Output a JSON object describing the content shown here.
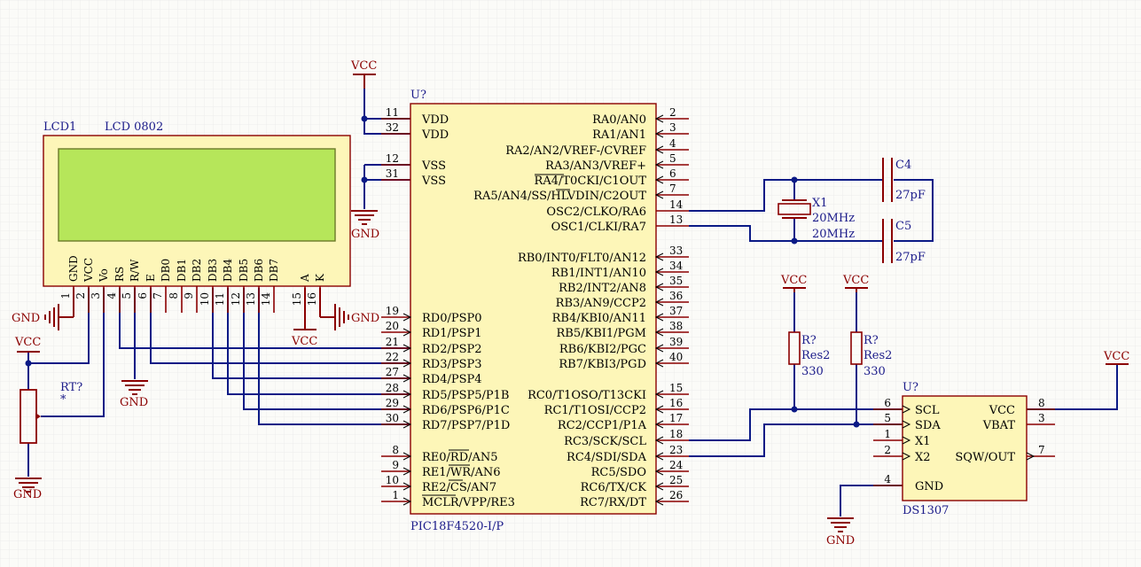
{
  "nets": {
    "vcc": "VCC",
    "gnd": "GND"
  },
  "lcd": {
    "designator": "LCD1",
    "part": "LCD 0802",
    "screen_color": "#b6e65a",
    "pin_names": [
      "GND",
      "VCC",
      "Vo",
      "RS",
      "R/W",
      "E",
      "DB0",
      "DB1",
      "DB2",
      "DB3",
      "DB4",
      "DB5",
      "DB6",
      "DB7",
      "A",
      "K"
    ],
    "pin_numbers": [
      "1",
      "2",
      "3",
      "4",
      "5",
      "6",
      "7",
      "8",
      "9",
      "10",
      "11",
      "12",
      "13",
      "14",
      "15",
      "16"
    ]
  },
  "rt": {
    "designator": "RT?",
    "value": "*"
  },
  "mcu": {
    "designator": "U?",
    "part": "PIC18F4520-I/P",
    "left_pins": [
      {
        "num": "11",
        "name": "VDD"
      },
      {
        "num": "32",
        "name": "VDD"
      },
      {
        "num": "12",
        "name": "VSS"
      },
      {
        "num": "31",
        "name": "VSS"
      },
      {
        "num": "19",
        "name": "RD0/PSP0"
      },
      {
        "num": "20",
        "name": "RD1/PSP1"
      },
      {
        "num": "21",
        "name": "RD2/PSP2"
      },
      {
        "num": "22",
        "name": "RD3/PSP3"
      },
      {
        "num": "27",
        "name": "RD4/PSP4"
      },
      {
        "num": "28",
        "name": "RD5/PSP5/P1B"
      },
      {
        "num": "29",
        "name": "RD6/PSP6/P1C"
      },
      {
        "num": "30",
        "name": "RD7/PSP7/P1D"
      },
      {
        "num": "8",
        "name": "RE0/RD/AN5"
      },
      {
        "num": "9",
        "name": "RE1/WR/AN6"
      },
      {
        "num": "10",
        "name": "RE2/CS/AN7"
      },
      {
        "num": "1",
        "name": "MCLR/VPP/RE3"
      }
    ],
    "right_pins": [
      {
        "num": "2",
        "name": "RA0/AN0"
      },
      {
        "num": "3",
        "name": "RA1/AN1"
      },
      {
        "num": "4",
        "name": "RA2/AN2/VREF-/CVREF"
      },
      {
        "num": "5",
        "name": "RA3/AN3/VREF+"
      },
      {
        "num": "6",
        "name": "RA4/T0CKI/C1OUT"
      },
      {
        "num": "7",
        "name": "RA5/AN4/SS/HLVDIN/C2OUT"
      },
      {
        "num": "14",
        "name": "OSC2/CLKO/RA6"
      },
      {
        "num": "13",
        "name": "OSC1/CLKI/RA7"
      },
      {
        "num": "33",
        "name": "RB0/INT0/FLT0/AN12"
      },
      {
        "num": "34",
        "name": "RB1/INT1/AN10"
      },
      {
        "num": "35",
        "name": "RB2/INT2/AN8"
      },
      {
        "num": "36",
        "name": "RB3/AN9/CCP2"
      },
      {
        "num": "37",
        "name": "RB4/KBI0/AN11"
      },
      {
        "num": "38",
        "name": "RB5/KBI1/PGM"
      },
      {
        "num": "39",
        "name": "RB6/KBI2/PGC"
      },
      {
        "num": "40",
        "name": "RB7/KBI3/PGD"
      },
      {
        "num": "15",
        "name": "RC0/T1OSO/T13CKI"
      },
      {
        "num": "16",
        "name": "RC1/T1OSI/CCP2"
      },
      {
        "num": "17",
        "name": "RC2/CCP1/P1A"
      },
      {
        "num": "18",
        "name": "RC3/SCK/SCL"
      },
      {
        "num": "23",
        "name": "RC4/SDI/SDA"
      },
      {
        "num": "24",
        "name": "RC5/SDO"
      },
      {
        "num": "25",
        "name": "RC6/TX/CK"
      },
      {
        "num": "26",
        "name": "RC7/RX/DT"
      }
    ]
  },
  "crystal": {
    "designator": "X1",
    "value": "20MHz",
    "value2": "20MHz"
  },
  "c4": {
    "designator": "C4",
    "value": "27pF"
  },
  "c5": {
    "designator": "C5",
    "value": "27pF"
  },
  "r1": {
    "designator": "R?",
    "part": "Res2",
    "value": "330"
  },
  "r2": {
    "designator": "R?",
    "part": "Res2",
    "value": "330"
  },
  "rtc": {
    "designator": "U?",
    "part": "DS1307",
    "left_pins": [
      {
        "num": "6",
        "name": "SCL"
      },
      {
        "num": "5",
        "name": "SDA"
      },
      {
        "num": "1",
        "name": "X1"
      },
      {
        "num": "2",
        "name": "X2"
      },
      {
        "num": "4",
        "name": "GND"
      }
    ],
    "right_pins": [
      {
        "num": "8",
        "name": "VCC"
      },
      {
        "num": "3",
        "name": "VBAT"
      },
      {
        "num": "7",
        "name": "SQW/OUT"
      }
    ]
  }
}
